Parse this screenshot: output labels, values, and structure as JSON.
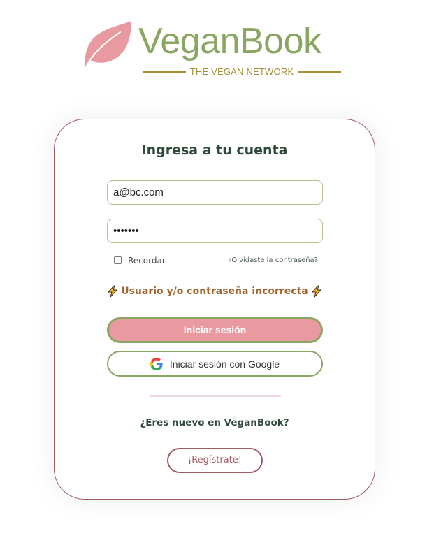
{
  "brand": {
    "name": "VeganBook",
    "tagline": "THE VEGAN NETWORK",
    "leaf_color": "#e89aa0",
    "text_color": "#8aa663",
    "tagline_color": "#a59036"
  },
  "login": {
    "title": "Ingresa a tu cuenta",
    "email_value": "a@bc.com",
    "password_value": "•••••••",
    "remember_label": "Recordar",
    "remember_checked": false,
    "forgot_link": "¿Olvidaste la contraseña?",
    "error_message": "Usuario y/o contraseña incorrecta",
    "error_icon": "lightning-bolt-icon",
    "submit_label": "Iniciar sesión",
    "google_label": "Iniciar sesión con Google",
    "google_icon": "google-icon"
  },
  "signup": {
    "prompt": "¿Eres nuevo en VeganBook?",
    "register_label": "¡Regístrate!"
  },
  "colors": {
    "accent_green": "#8aa663",
    "accent_pink": "#e89aa0",
    "accent_rose": "#a45a62",
    "error_brown": "#a4652f",
    "heading_dark_green": "#2f4a3a"
  }
}
